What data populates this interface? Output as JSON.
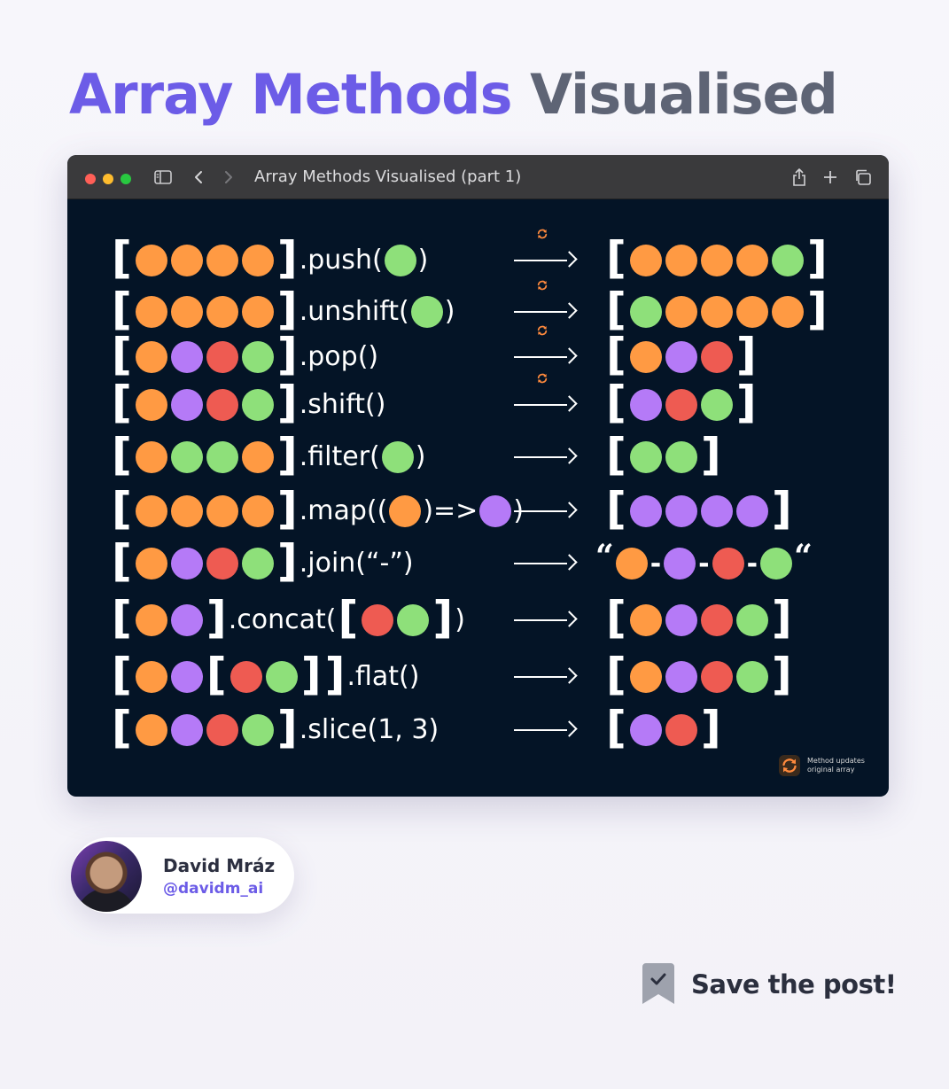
{
  "title": {
    "part1": "Array Methods",
    "part2": "Visualised"
  },
  "window": {
    "tab_title": "Array Methods Visualised (part 1)",
    "traffic_lights": [
      "#ff5f57",
      "#febc2e",
      "#28c840"
    ]
  },
  "colors": {
    "orange": "#ff9a43",
    "green": "#8ee07a",
    "purple": "#b57af7",
    "red": "#ee5b52",
    "accent": "#6c5ce7",
    "mutates_icon": "#ff8a3d"
  },
  "methods": [
    {
      "input": [
        "o",
        "o",
        "o",
        "o"
      ],
      "call_pre": ".push(",
      "call_balls": [
        "g"
      ],
      "call_post": ")",
      "mutates": true,
      "output": [
        "o",
        "o",
        "o",
        "o",
        "g"
      ]
    },
    {
      "input": [
        "o",
        "o",
        "o",
        "o"
      ],
      "call_pre": ".unshift(",
      "call_balls": [
        "g"
      ],
      "call_post": ")",
      "mutates": true,
      "output": [
        "g",
        "o",
        "o",
        "o",
        "o"
      ]
    },
    {
      "input": [
        "o",
        "p",
        "r",
        "g"
      ],
      "call_pre": ".pop()",
      "mutates": true,
      "output": [
        "o",
        "p",
        "r"
      ]
    },
    {
      "input": [
        "o",
        "p",
        "r",
        "g"
      ],
      "call_pre": ".shift()",
      "mutates": true,
      "output": [
        "p",
        "r",
        "g"
      ]
    },
    {
      "input": [
        "o",
        "g",
        "g",
        "o"
      ],
      "call_pre": ".filter(",
      "call_balls": [
        "g"
      ],
      "call_post": ")",
      "mutates": false,
      "output": [
        "g",
        "g"
      ]
    },
    {
      "input": [
        "o",
        "o",
        "o",
        "o"
      ],
      "call_pre": ".map((",
      "call_balls": [
        "o"
      ],
      "call_mid": ")=>",
      "call_balls2": [
        "p"
      ],
      "call_post": ")",
      "mutates": false,
      "output": [
        "p",
        "p",
        "p",
        "p"
      ]
    },
    {
      "input": [
        "o",
        "p",
        "r",
        "g"
      ],
      "call_pre": ".join(“-”)",
      "mutates": false,
      "output_string": [
        "o",
        "p",
        "r",
        "g"
      ],
      "output_quote": "“",
      "output_sep": "-"
    },
    {
      "input": [
        "o",
        "p"
      ],
      "call_pre": ".concat(",
      "call_array": [
        "r",
        "g"
      ],
      "call_post": ")",
      "mutates": false,
      "output": [
        "o",
        "p",
        "r",
        "g"
      ]
    },
    {
      "input": [
        "o",
        "p"
      ],
      "input_nested": [
        "r",
        "g"
      ],
      "call_pre": ".flat()",
      "mutates": false,
      "output": [
        "o",
        "p",
        "r",
        "g"
      ]
    },
    {
      "input": [
        "o",
        "p",
        "r",
        "g"
      ],
      "call_pre": ".slice(1, 3)",
      "mutates": false,
      "output": [
        "p",
        "r"
      ]
    }
  ],
  "legend": {
    "icon": "refresh-icon",
    "text": "Method updates original array"
  },
  "author": {
    "name": "David Mráz",
    "handle": "@davidm_ai"
  },
  "save": {
    "label": "Save the post!",
    "icon": "bookmark-check-icon"
  }
}
